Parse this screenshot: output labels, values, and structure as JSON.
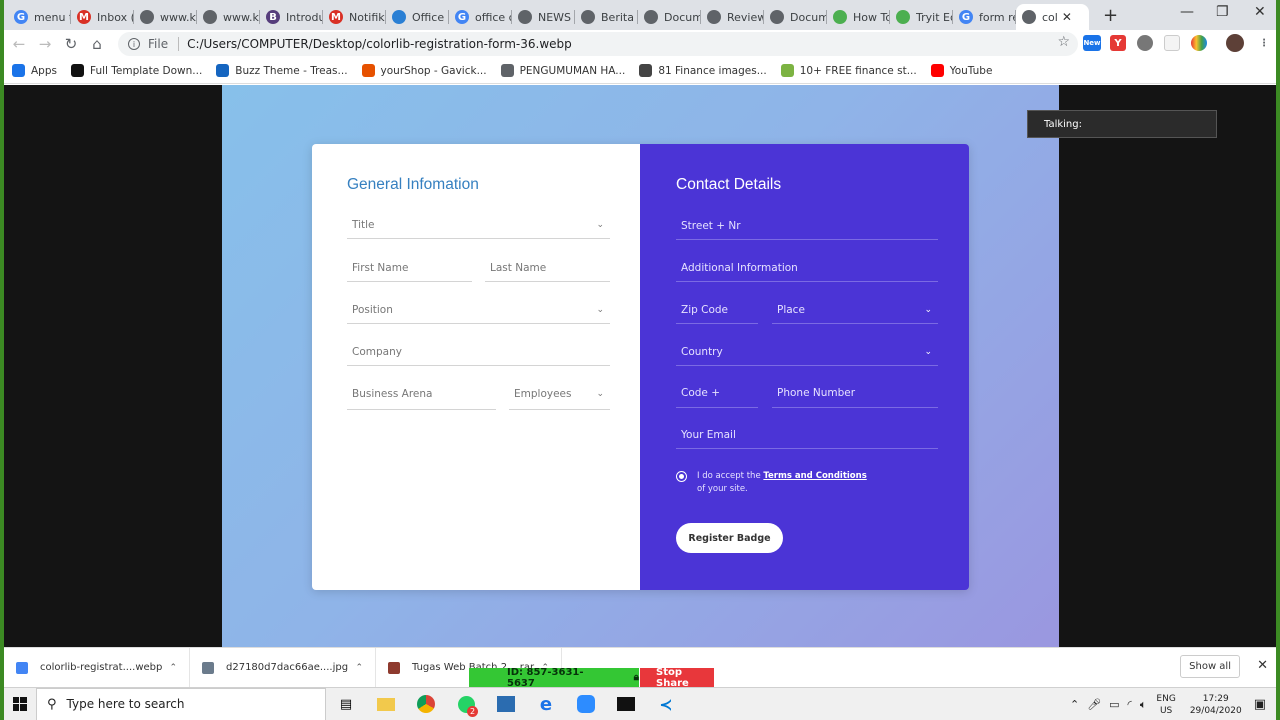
{
  "browser": {
    "tabs": [
      {
        "label": "menu t",
        "icon": "G",
        "color": "#4285f4"
      },
      {
        "label": "Inbox (",
        "icon": "M",
        "color": "#d93025"
      },
      {
        "label": "www.k",
        "icon": "",
        "color": "#5f6368"
      },
      {
        "label": "www.k",
        "icon": "",
        "color": "#5f6368"
      },
      {
        "label": "Introdu",
        "icon": "B",
        "color": "#563d7c"
      },
      {
        "label": "Notifik",
        "icon": "M",
        "color": "#d93025"
      },
      {
        "label": "Office",
        "icon": "",
        "color": "#2a7fd4"
      },
      {
        "label": "office c",
        "icon": "G",
        "color": "#4285f4"
      },
      {
        "label": "NEWS",
        "icon": "",
        "color": "#5f6368"
      },
      {
        "label": "Berita",
        "icon": "",
        "color": "#5f6368"
      },
      {
        "label": "Docum",
        "icon": "",
        "color": "#5f6368"
      },
      {
        "label": "Review",
        "icon": "",
        "color": "#5f6368"
      },
      {
        "label": "Docum",
        "icon": "",
        "color": "#5f6368"
      },
      {
        "label": "How To",
        "icon": "",
        "color": "#4caf50"
      },
      {
        "label": "Tryit Ec",
        "icon": "",
        "color": "#4caf50"
      },
      {
        "label": "form re",
        "icon": "G",
        "color": "#4285f4"
      }
    ],
    "active_tab": {
      "label": "col"
    },
    "new_tab": "+",
    "window_controls": {
      "minimize": "—",
      "maximize": "❐",
      "close": "✕"
    },
    "address": {
      "scheme_label": "File",
      "url": "C:/Users/COMPUTER/Desktop/colorlib-registration-form-36.webp"
    },
    "extension_badge": "New",
    "bookmarks": [
      {
        "label": "Apps",
        "color": "#1a73e8"
      },
      {
        "label": "Full Template Down...",
        "color": "#111"
      },
      {
        "label": "Buzz Theme - Treas...",
        "color": "#1565c0"
      },
      {
        "label": "yourShop - Gavick...",
        "color": "#e65100"
      },
      {
        "label": "PENGUMUMAN HA...",
        "color": "#5f6368"
      },
      {
        "label": "81 Finance images...",
        "color": "#444"
      },
      {
        "label": "10+ FREE finance st...",
        "color": "#7cb342"
      },
      {
        "label": "YouTube",
        "color": "#ff0000"
      }
    ]
  },
  "form": {
    "general": {
      "heading": "General Infomation",
      "title": "Title",
      "first_name": "First Name",
      "last_name": "Last Name",
      "position": "Position",
      "company": "Company",
      "business_arena": "Business Arena",
      "employees": "Employees"
    },
    "contact": {
      "heading": "Contact Details",
      "street": "Street + Nr",
      "additional": "Additional Information",
      "zip": "Zip Code",
      "place": "Place",
      "country": "Country",
      "code": "Code +",
      "phone": "Phone Number",
      "email": "Your Email",
      "terms_prefix": "I do accept the ",
      "terms_link": "Terms and Conditions",
      "terms_suffix": " of your site.",
      "register_button": "Register Badge"
    }
  },
  "overlay": {
    "talking": "Talking:"
  },
  "downloads": {
    "items": [
      {
        "label": "colorlib-registrat....webp",
        "color": "#4285f4"
      },
      {
        "label": "d27180d7dac66ae....jpg",
        "color": "#6b7b8c"
      },
      {
        "label": "Tugas Web Batch 2....rar",
        "color": "#8e3a2e"
      }
    ],
    "show_all": "Show all",
    "close": "✕"
  },
  "share_bar": {
    "id": "ID: 857-3631-5637",
    "stop": "Stop Share"
  },
  "taskbar": {
    "search_placeholder": "Type here to search",
    "notification_count": "2",
    "lang": "ENG",
    "region": "US",
    "time": "17:29",
    "date": "29/04/2020"
  }
}
